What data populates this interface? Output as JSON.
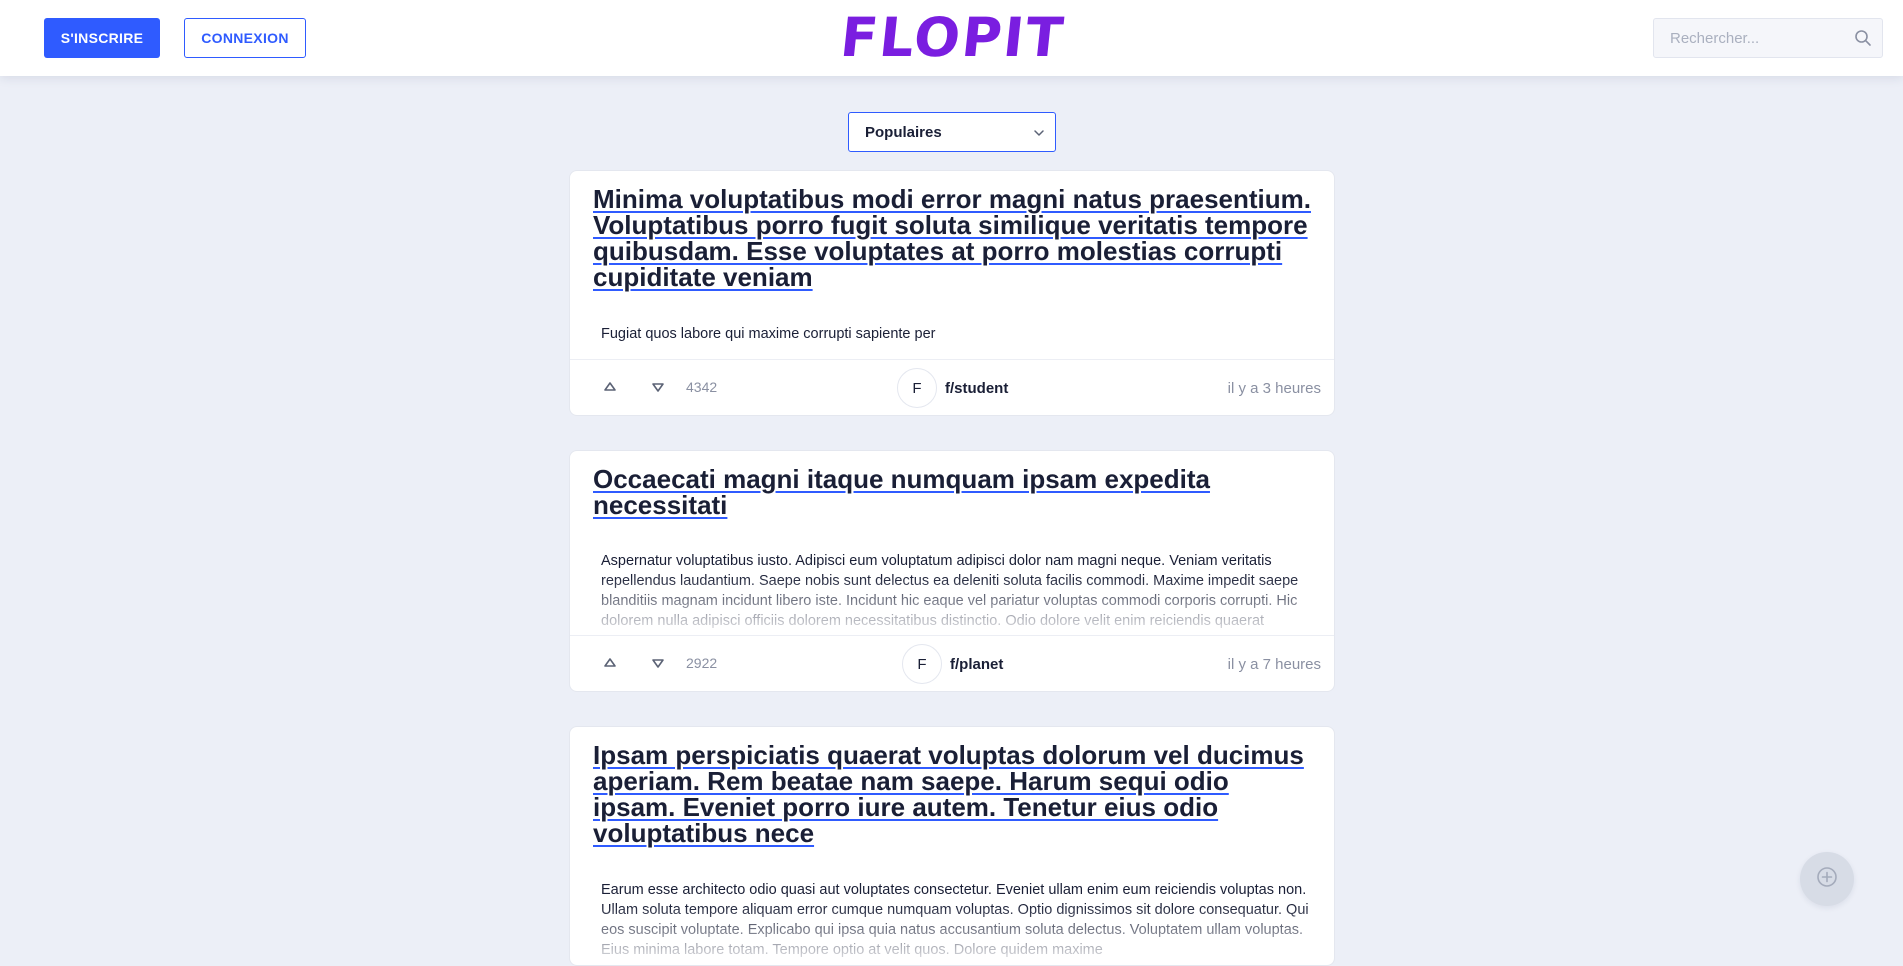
{
  "header": {
    "signup_label": "S'INSCRIRE",
    "login_label": "CONNEXION",
    "logo_text": "FLOPIT",
    "logo_color": "#7a1ee0",
    "search_placeholder": "Rechercher...",
    "search_icon": "search-icon",
    "accent_color": "#2f5bff"
  },
  "sort": {
    "selected": "Populaires",
    "icon": "chevron-down-icon"
  },
  "posts": [
    {
      "title": "Minima voluptatibus modi error magni natus praesentium. Voluptatibus porro fugit soluta similique veritatis tempore quibusdam. Esse voluptates at porro molestias corrupti cupiditate veniam",
      "body": "Fugiat quos labore qui maxime corrupti sapiente per",
      "score": "4342",
      "community_initial": "F",
      "community": "f/student",
      "time": "il y a 3 heures"
    },
    {
      "title": "Occaecati magni itaque numquam ipsam expedita necessitati",
      "body": "Aspernatur voluptatibus iusto. Adipisci eum voluptatum adipisci dolor nam magni neque. Veniam veritatis repellendus laudantium. Saepe nobis sunt delectus ea deleniti soluta facilis commodi. Maxime impedit saepe blanditiis magnam incidunt libero iste. Incidunt hic eaque vel pariatur voluptas commodi corporis corrupti. Hic dolorem nulla adipisci officiis dolorem necessitatibus distinctio. Odio dolore velit enim reiciendis quaerat",
      "score": "2922",
      "community_initial": "F",
      "community": "f/planet",
      "time": "il y a 7 heures"
    },
    {
      "title": "Ipsam perspiciatis quaerat voluptas dolorum vel ducimus aperiam. Rem beatae nam saepe. Harum sequi odio ipsam. Eveniet porro iure autem. Tenetur eius odio voluptatibus nece",
      "body": "Earum esse architecto odio quasi aut voluptates consectetur. Eveniet ullam enim eum reiciendis voluptas non. Ullam soluta tempore aliquam error cumque numquam voluptas. Optio dignissimos sit dolore consequatur. Qui eos suscipit voluptate. Explicabo qui ipsa quia natus accusantium soluta delectus. Voluptatem ullam voluptas. Eius minima labore totam. Tempore optio at velit quos. Dolore quidem maxime"
    }
  ],
  "fab_icon": "plus-circle-icon"
}
